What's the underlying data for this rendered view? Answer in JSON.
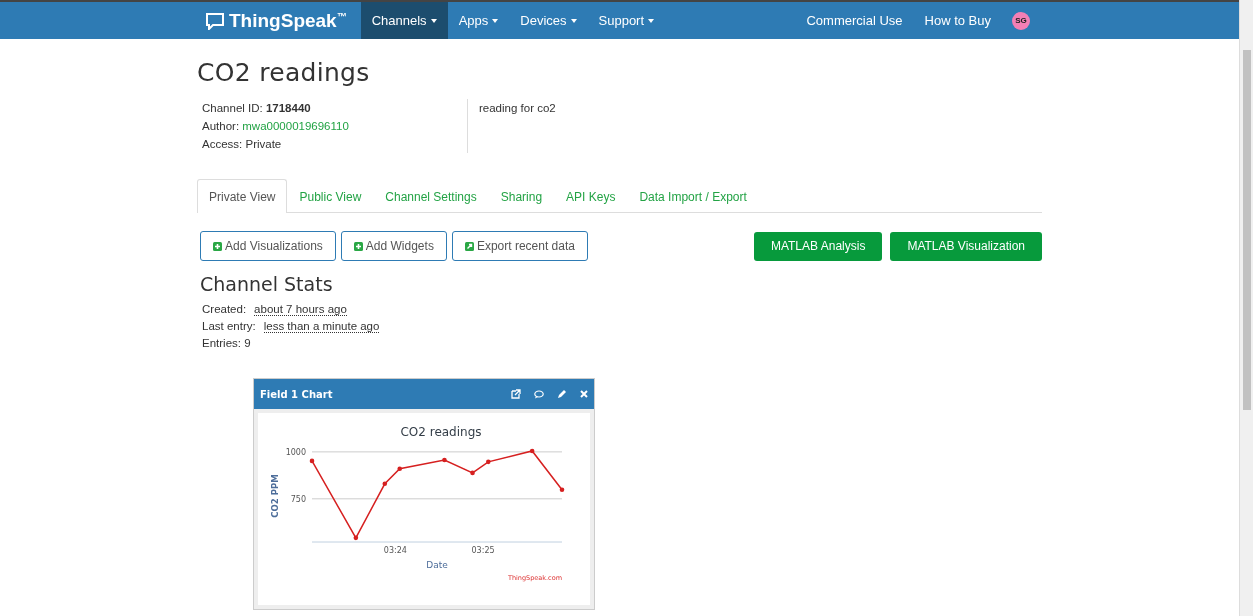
{
  "navbar": {
    "logo": "ThingSpeak",
    "trademark": "™",
    "menus": [
      {
        "label": "Channels",
        "selected": true
      },
      {
        "label": "Apps",
        "selected": false
      },
      {
        "label": "Devices",
        "selected": false
      },
      {
        "label": "Support",
        "selected": false
      }
    ],
    "links": [
      "Commercial Use",
      "How to Buy"
    ],
    "avatar": "SG"
  },
  "channel": {
    "title": "CO2 readings",
    "id_label": "Channel ID:",
    "id": "1718440",
    "author_label": "Author:",
    "author": "mwa0000019696110",
    "access": "Access: Private",
    "description": "reading for co2"
  },
  "tabs": [
    {
      "label": "Private View",
      "selected": true
    },
    {
      "label": "Public View",
      "selected": false
    },
    {
      "label": "Channel Settings",
      "selected": false
    },
    {
      "label": "Sharing",
      "selected": false
    },
    {
      "label": "API Keys",
      "selected": false
    },
    {
      "label": "Data Import / Export",
      "selected": false
    }
  ],
  "actions": [
    {
      "label": "Add Visualizations",
      "kind": "plus"
    },
    {
      "label": "Add Widgets",
      "kind": "plus"
    },
    {
      "label": "Export recent data",
      "kind": "export"
    }
  ],
  "matlab_buttons": [
    "MATLAB Analysis",
    "MATLAB Visualization"
  ],
  "stats": {
    "title": "Channel Stats",
    "rows": [
      {
        "label": "Created:",
        "value": "about 7 hours ago"
      },
      {
        "label": "Last entry:",
        "value": "less than a minute ago"
      }
    ],
    "entries": "Entries: 9"
  },
  "widget": {
    "title": "Field 1 Chart",
    "credit": "ThingSpeak.com",
    "chart_data": {
      "type": "line",
      "title": "CO2 readings",
      "xlabel": "Date",
      "ylabel": "CO2 PPM",
      "x": [
        203.05,
        203.55,
        203.88,
        204.05,
        204.56,
        204.88,
        205.06,
        205.56,
        205.9
      ],
      "series": [
        {
          "color": "#d62020",
          "values": [
            952,
            542,
            830,
            910,
            957,
            888,
            947,
            1005,
            798
          ]
        }
      ],
      "xlim": [
        203.05,
        205.9
      ],
      "ylim": [
        520,
        1010
      ],
      "xticks": [
        {
          "value": 204,
          "label": "03:24"
        },
        {
          "value": 205,
          "label": "03:25"
        }
      ],
      "yticks": [
        750,
        1000
      ]
    }
  }
}
